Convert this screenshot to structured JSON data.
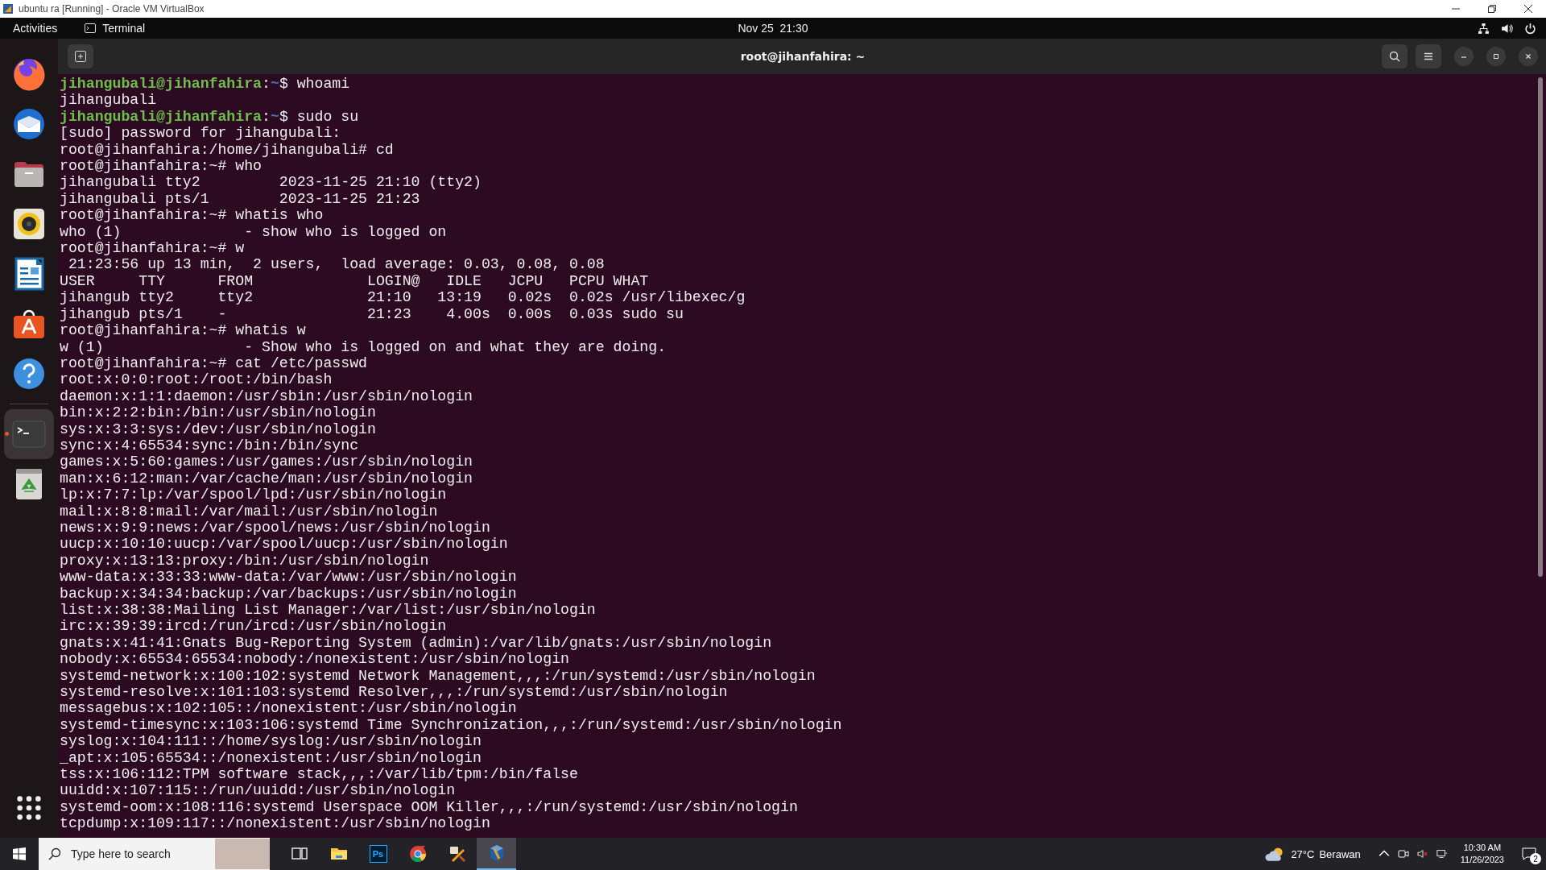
{
  "vm_window": {
    "title": "ubuntu ra [Running] - Oracle VM VirtualBox"
  },
  "top_bar": {
    "activities": "Activities",
    "app_menu": "Terminal",
    "clock": "Nov 25  21:30"
  },
  "dock": {
    "items": [
      {
        "kind": "firefox",
        "running": false
      },
      {
        "kind": "thunderbird",
        "running": false
      },
      {
        "kind": "files",
        "running": false
      },
      {
        "kind": "rhythmbox",
        "running": false
      },
      {
        "kind": "writer",
        "running": false
      },
      {
        "kind": "software",
        "running": false
      },
      {
        "kind": "help",
        "running": false
      },
      {
        "kind": "separator"
      },
      {
        "kind": "terminal",
        "running": true
      },
      {
        "kind": "trash",
        "running": false
      }
    ]
  },
  "terminal": {
    "title": "root@jihanfahira: ~",
    "lines": [
      {
        "kind": "prompt",
        "user_host": "jihangubali@jihanfahira",
        "separator": ":",
        "path": "~",
        "command": "$ whoami"
      },
      {
        "kind": "output",
        "text": "jihangubali"
      },
      {
        "kind": "prompt",
        "user_host": "jihangubali@jihanfahira",
        "separator": ":",
        "path": "~",
        "command": "$ sudo su"
      },
      {
        "kind": "output",
        "text": "[sudo] password for jihangubali:"
      },
      {
        "kind": "output",
        "text": "root@jihanfahira:/home/jihangubali# cd"
      },
      {
        "kind": "output",
        "text": "root@jihanfahira:~# who"
      },
      {
        "kind": "output",
        "text": "jihangubali tty2         2023-11-25 21:10 (tty2)"
      },
      {
        "kind": "output",
        "text": "jihangubali pts/1        2023-11-25 21:23"
      },
      {
        "kind": "output",
        "text": "root@jihanfahira:~# whatis who"
      },
      {
        "kind": "output",
        "text": "who (1)              - show who is logged on"
      },
      {
        "kind": "output",
        "text": "root@jihanfahira:~# w"
      },
      {
        "kind": "output",
        "text": " 21:23:56 up 13 min,  2 users,  load average: 0.03, 0.08, 0.08"
      },
      {
        "kind": "output",
        "text": "USER     TTY      FROM             LOGIN@   IDLE   JCPU   PCPU WHAT"
      },
      {
        "kind": "output",
        "text": "jihangub tty2     tty2             21:10   13:19   0.02s  0.02s /usr/libexec/g"
      },
      {
        "kind": "output",
        "text": "jihangub pts/1    -                21:23    4.00s  0.00s  0.03s sudo su"
      },
      {
        "kind": "output",
        "text": "root@jihanfahira:~# whatis w"
      },
      {
        "kind": "output",
        "text": "w (1)                - Show who is logged on and what they are doing."
      },
      {
        "kind": "output",
        "text": "root@jihanfahira:~# cat /etc/passwd"
      },
      {
        "kind": "output",
        "text": "root:x:0:0:root:/root:/bin/bash"
      },
      {
        "kind": "output",
        "text": "daemon:x:1:1:daemon:/usr/sbin:/usr/sbin/nologin"
      },
      {
        "kind": "output",
        "text": "bin:x:2:2:bin:/bin:/usr/sbin/nologin"
      },
      {
        "kind": "output",
        "text": "sys:x:3:3:sys:/dev:/usr/sbin/nologin"
      },
      {
        "kind": "output",
        "text": "sync:x:4:65534:sync:/bin:/bin/sync"
      },
      {
        "kind": "output",
        "text": "games:x:5:60:games:/usr/games:/usr/sbin/nologin"
      },
      {
        "kind": "output",
        "text": "man:x:6:12:man:/var/cache/man:/usr/sbin/nologin"
      },
      {
        "kind": "output",
        "text": "lp:x:7:7:lp:/var/spool/lpd:/usr/sbin/nologin"
      },
      {
        "kind": "output",
        "text": "mail:x:8:8:mail:/var/mail:/usr/sbin/nologin"
      },
      {
        "kind": "output",
        "text": "news:x:9:9:news:/var/spool/news:/usr/sbin/nologin"
      },
      {
        "kind": "output",
        "text": "uucp:x:10:10:uucp:/var/spool/uucp:/usr/sbin/nologin"
      },
      {
        "kind": "output",
        "text": "proxy:x:13:13:proxy:/bin:/usr/sbin/nologin"
      },
      {
        "kind": "output",
        "text": "www-data:x:33:33:www-data:/var/www:/usr/sbin/nologin"
      },
      {
        "kind": "output",
        "text": "backup:x:34:34:backup:/var/backups:/usr/sbin/nologin"
      },
      {
        "kind": "output",
        "text": "list:x:38:38:Mailing List Manager:/var/list:/usr/sbin/nologin"
      },
      {
        "kind": "output",
        "text": "irc:x:39:39:ircd:/run/ircd:/usr/sbin/nologin"
      },
      {
        "kind": "output",
        "text": "gnats:x:41:41:Gnats Bug-Reporting System (admin):/var/lib/gnats:/usr/sbin/nologin"
      },
      {
        "kind": "output",
        "text": "nobody:x:65534:65534:nobody:/nonexistent:/usr/sbin/nologin"
      },
      {
        "kind": "output",
        "text": "systemd-network:x:100:102:systemd Network Management,,,:/run/systemd:/usr/sbin/nologin"
      },
      {
        "kind": "output",
        "text": "systemd-resolve:x:101:103:systemd Resolver,,,:/run/systemd:/usr/sbin/nologin"
      },
      {
        "kind": "output",
        "text": "messagebus:x:102:105::/nonexistent:/usr/sbin/nologin"
      },
      {
        "kind": "output",
        "text": "systemd-timesync:x:103:106:systemd Time Synchronization,,,:/run/systemd:/usr/sbin/nologin"
      },
      {
        "kind": "output",
        "text": "syslog:x:104:111::/home/syslog:/usr/sbin/nologin"
      },
      {
        "kind": "output",
        "text": "_apt:x:105:65534::/nonexistent:/usr/sbin/nologin"
      },
      {
        "kind": "output",
        "text": "tss:x:106:112:TPM software stack,,,:/var/lib/tpm:/bin/false"
      },
      {
        "kind": "output",
        "text": "uuidd:x:107:115::/run/uuidd:/usr/sbin/nologin"
      },
      {
        "kind": "output",
        "text": "systemd-oom:x:108:116:systemd Userspace OOM Killer,,,:/run/systemd:/usr/sbin/nologin"
      },
      {
        "kind": "output",
        "text": "tcpdump:x:109:117::/nonexistent:/usr/sbin/nologin"
      }
    ]
  },
  "taskbar": {
    "search": {
      "placeholder": "Type here to search"
    },
    "apps": [
      {
        "kind": "task_view",
        "active": false
      },
      {
        "kind": "explorer",
        "active": false
      },
      {
        "kind": "photoshop",
        "label": "Ps",
        "active": false
      },
      {
        "kind": "chrome",
        "active": false
      },
      {
        "kind": "tool",
        "active": false
      },
      {
        "kind": "virtualbox",
        "active": true
      }
    ],
    "weather": {
      "temperature": "27°C",
      "condition": "Berawan"
    },
    "time": "10:30 AM",
    "date": "11/26/2023",
    "notifications": "2"
  }
}
